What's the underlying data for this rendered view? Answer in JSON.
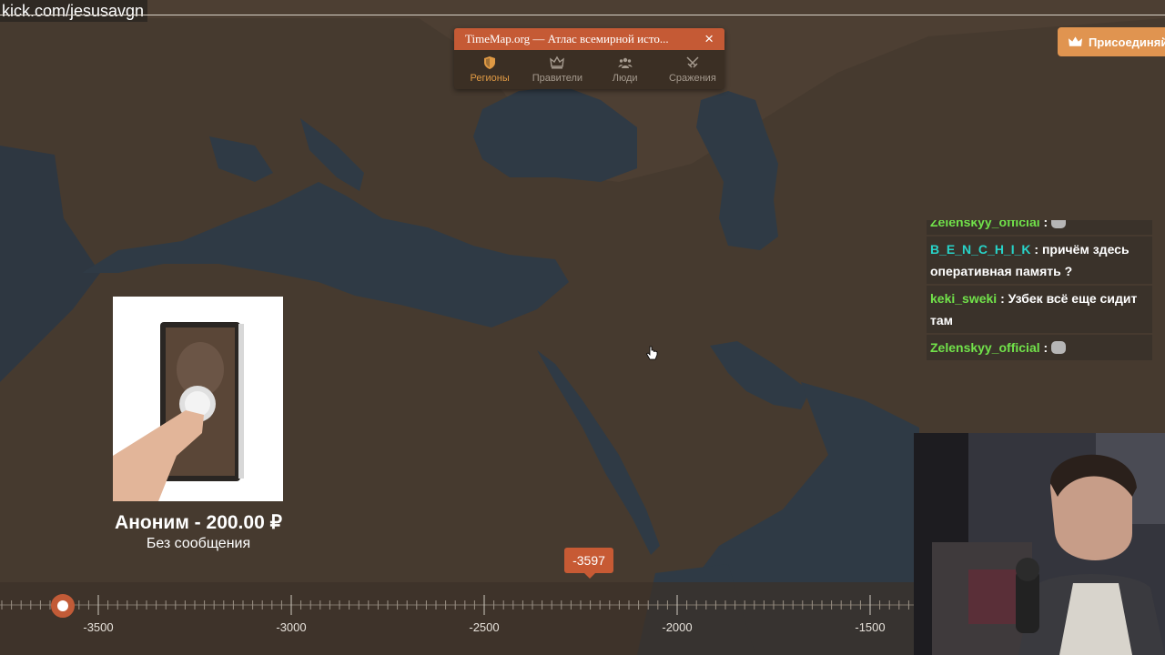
{
  "stream": {
    "url": "kick.com/jesusavgn"
  },
  "timemap": {
    "title": "TimeMap.org — Атлас всемирной исто...",
    "close": "×",
    "tabs": [
      {
        "label": "Регионы",
        "icon": "shield-icon",
        "active": true
      },
      {
        "label": "Правители",
        "icon": "crown-icon",
        "active": false
      },
      {
        "label": "Люди",
        "icon": "people-icon",
        "active": false
      },
      {
        "label": "Сражения",
        "icon": "swords-icon",
        "active": false
      }
    ]
  },
  "join_button": {
    "label": "Присоединяй",
    "icon": "crown-icon"
  },
  "chat": {
    "messages": [
      {
        "user": "Zelenskyy_official",
        "text": ":"
      },
      {
        "user": "B_E_N_C_H_I_K",
        "text": ": причём здесь оперативная память ?"
      },
      {
        "user": "keki_sweki",
        "text": ": Узбек всё еще сидит там"
      },
      {
        "user": "Zelenskyy_official",
        "text": ":"
      }
    ]
  },
  "donation": {
    "line": "Аноним - 200.00 ₽",
    "message": "Без сообщения"
  },
  "timeline": {
    "current_year": "-3597",
    "labels": [
      "-3500",
      "-3000",
      "-2500",
      "-2000",
      "-1500"
    ]
  },
  "colors": {
    "accent": "#c55a35",
    "join": "#e09450",
    "land": "#52402f",
    "sea": "#2f3a45"
  }
}
